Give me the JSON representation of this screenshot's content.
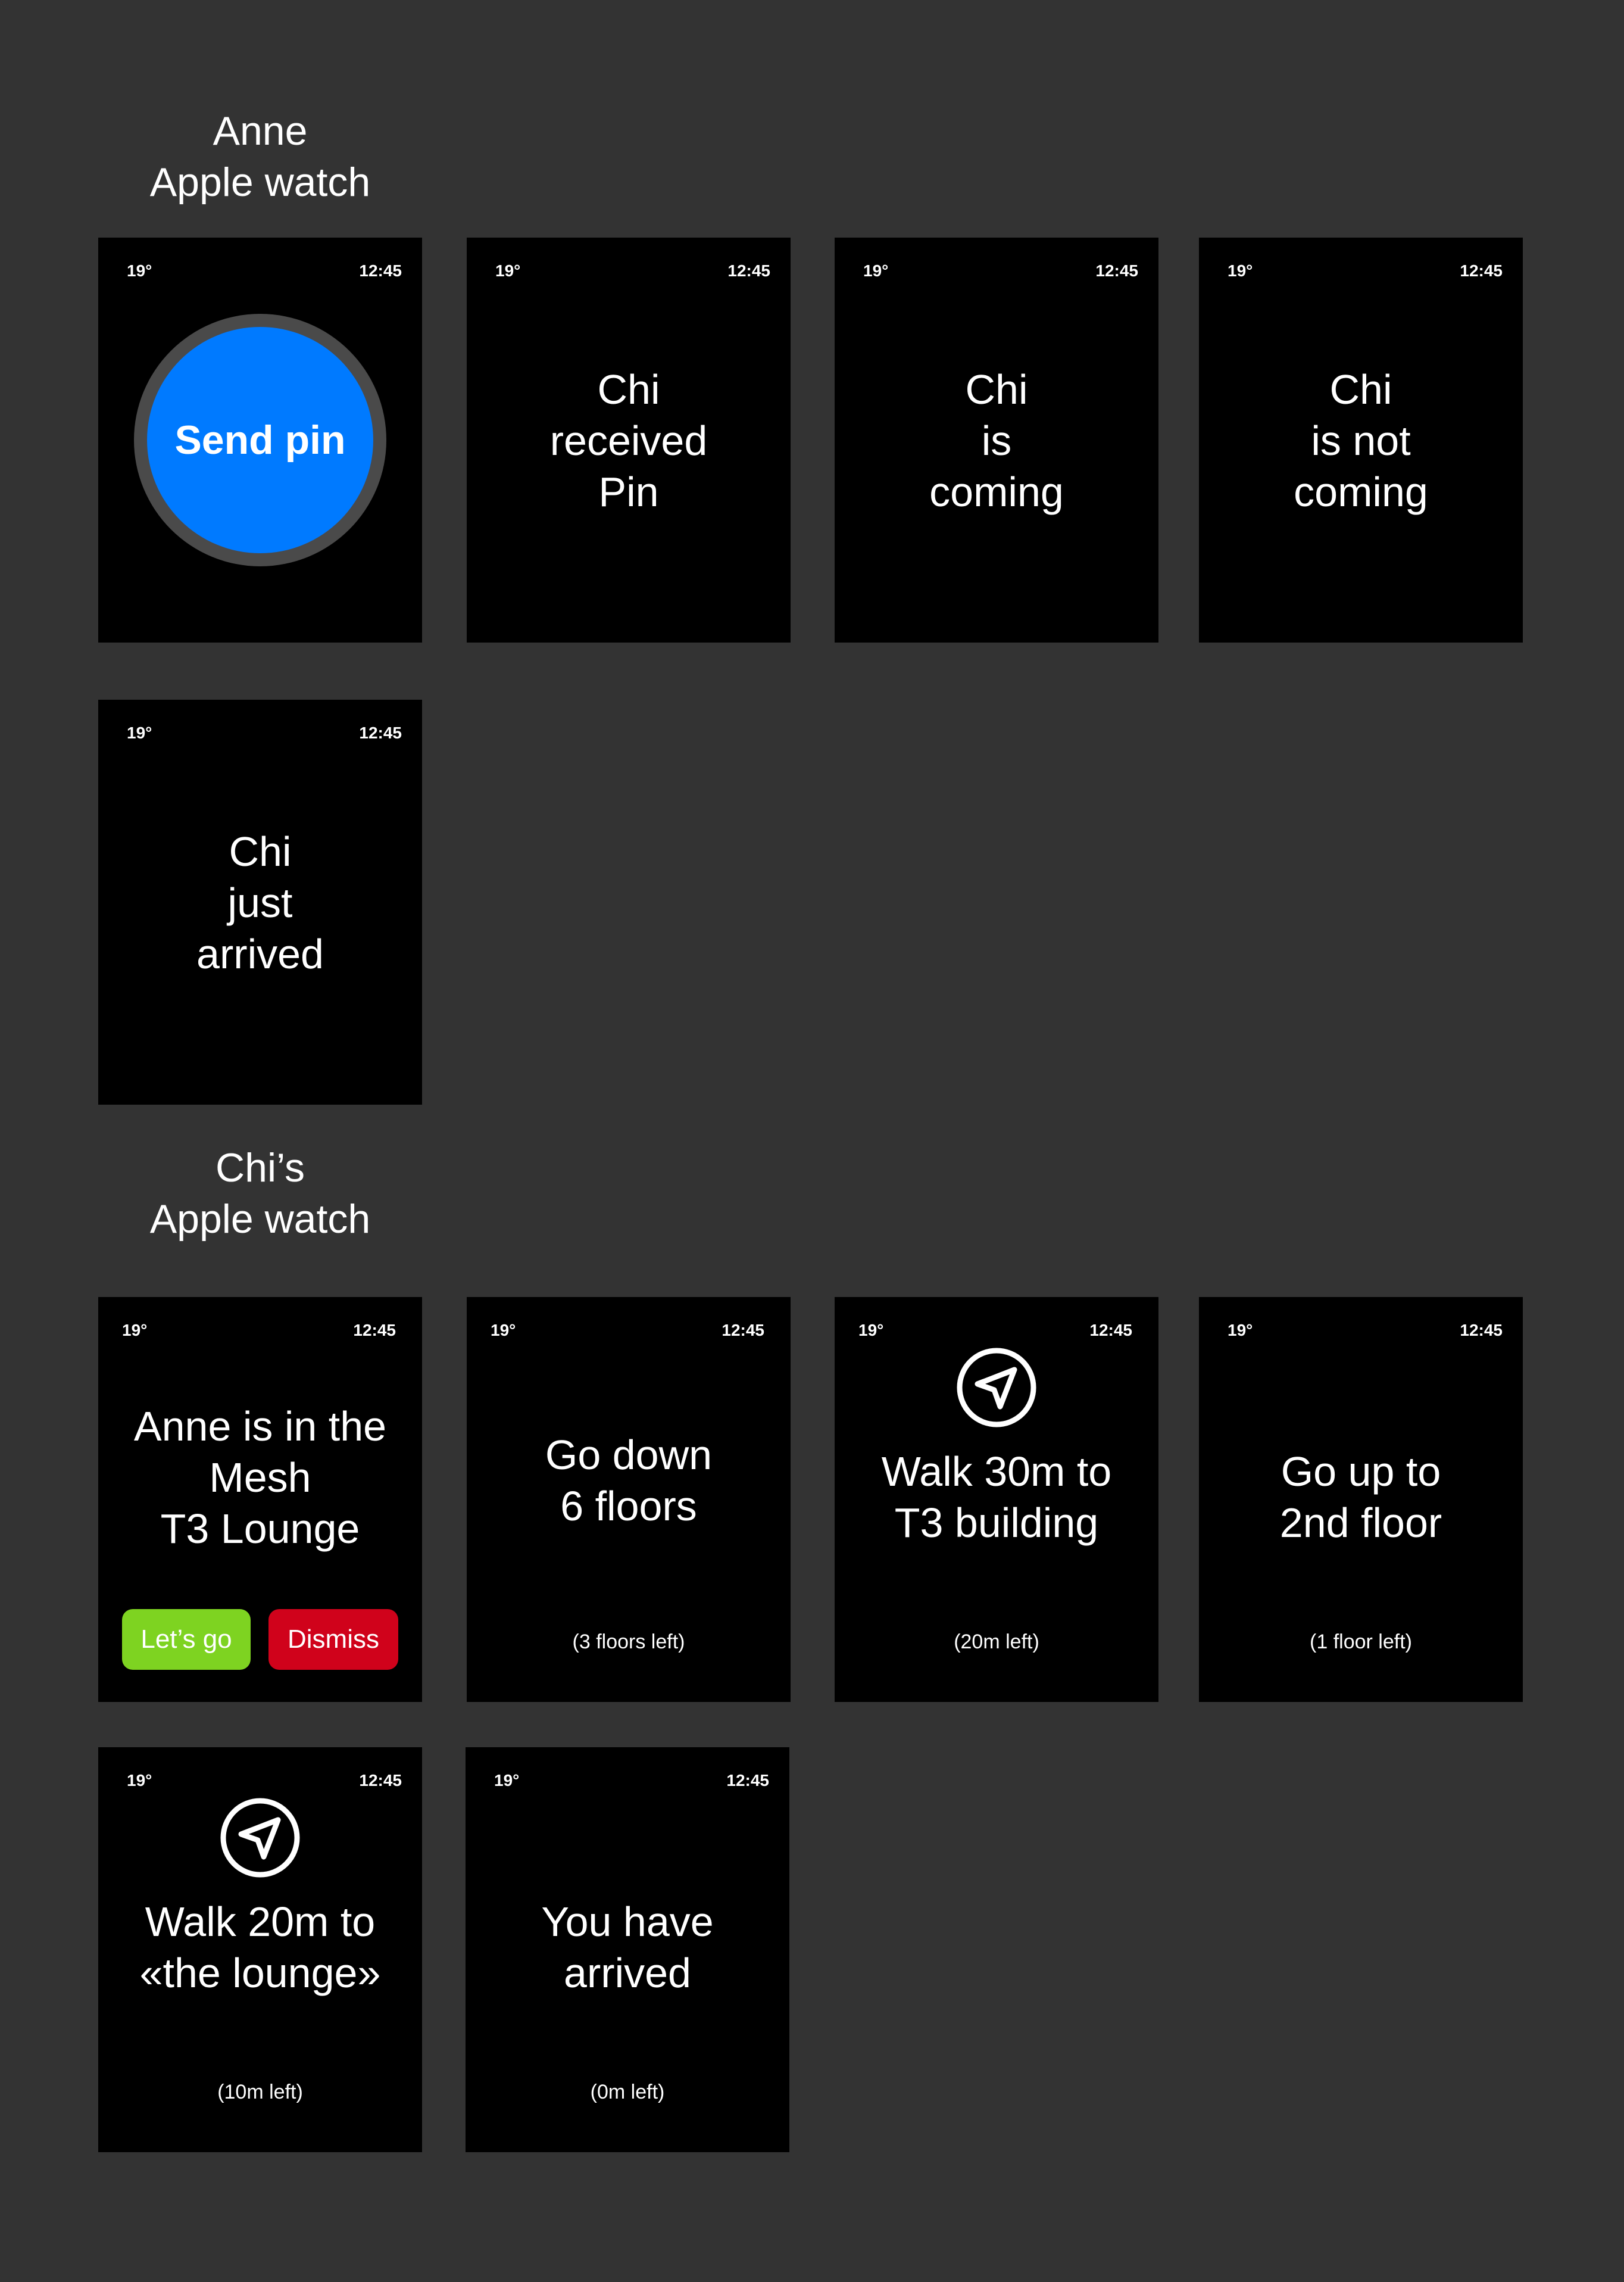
{
  "sections": {
    "anne": {
      "title_line1": "Anne",
      "title_line2": "Apple watch"
    },
    "chi": {
      "title_line1": "Chi’s",
      "title_line2": "Apple watch"
    }
  },
  "status": {
    "temperature": "19°",
    "time": "12:45"
  },
  "anne_screens": {
    "send_pin": {
      "button_label": "Send pin",
      "button_color": "#007aff"
    },
    "received": {
      "lines": [
        "Chi",
        "received",
        "Pin"
      ]
    },
    "coming": {
      "lines": [
        "Chi",
        "is",
        "coming"
      ]
    },
    "not_coming": {
      "lines": [
        "Chi",
        "is not",
        "coming"
      ]
    },
    "arrived": {
      "lines": [
        "Chi",
        "just",
        "arrived"
      ]
    }
  },
  "chi_screens": {
    "invite": {
      "lines": [
        "Anne is in the",
        "Mesh",
        "T3 Lounge"
      ],
      "accept_label": "Let’s go",
      "dismiss_label": "Dismiss",
      "accept_color": "#7ed321",
      "dismiss_color": "#d0021b"
    },
    "go_down": {
      "lines": [
        "Go down",
        "6 floors"
      ],
      "remaining": "(3 floors left)"
    },
    "walk_building": {
      "icon": "navigation-arrow-icon",
      "lines": [
        "Walk 30m to",
        "T3 building"
      ],
      "remaining": "(20m left)"
    },
    "go_up": {
      "lines": [
        "Go up to",
        "2nd floor"
      ],
      "remaining": "(1 floor left)"
    },
    "walk_lounge": {
      "icon": "navigation-arrow-icon",
      "lines": [
        "Walk 20m to",
        "«the lounge»"
      ],
      "remaining": "(10m left)"
    },
    "arrived": {
      "lines": [
        "You have",
        "arrived"
      ],
      "remaining": "(0m left)"
    }
  }
}
